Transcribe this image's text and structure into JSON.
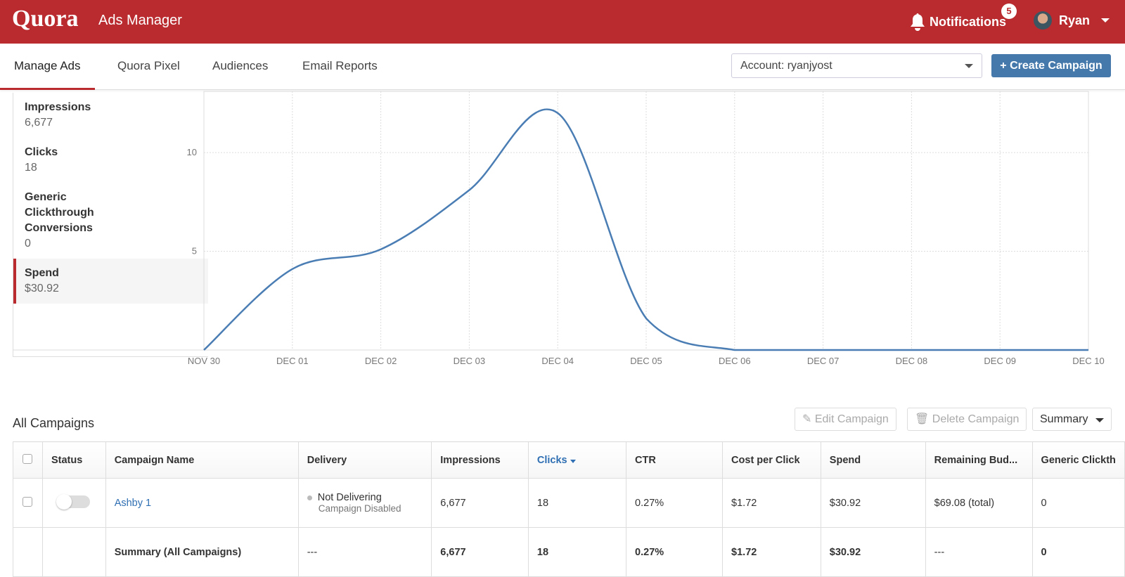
{
  "header": {
    "logo": "Quora",
    "app_title": "Ads Manager",
    "notifications_label": "Notifications",
    "notifications_count": "5",
    "user_name": "Ryan"
  },
  "nav": {
    "tabs": [
      {
        "label": "Manage Ads"
      },
      {
        "label": "Quora Pixel"
      },
      {
        "label": "Audiences"
      },
      {
        "label": "Email Reports"
      }
    ],
    "account_select": "Account: ryanjyost",
    "create_button": "+ Create Campaign"
  },
  "metrics": [
    {
      "name": "Impressions",
      "value": "6,677"
    },
    {
      "name": "Clicks",
      "value": "18"
    },
    {
      "name": "Generic Clickthrough Conversions",
      "value": "0"
    },
    {
      "name": "Spend",
      "value": "$30.92"
    }
  ],
  "colors": {
    "brand": "#b92b2f",
    "line": "#4a7db3",
    "primary": "#4579ab"
  },
  "chart_data": {
    "type": "line",
    "title": "Spend",
    "x": [
      "NOV 30",
      "DEC 01",
      "DEC 02",
      "DEC 03",
      "DEC 04",
      "DEC 05",
      "DEC 06",
      "DEC 07",
      "DEC 08",
      "DEC 09",
      "DEC 10"
    ],
    "series": [
      {
        "name": "Spend",
        "values": [
          0,
          4.1,
          5.1,
          8.1,
          12,
          1.6,
          0,
          0,
          0,
          0,
          0
        ]
      }
    ],
    "yticks": [
      5,
      10
    ],
    "ylim": [
      0,
      13.1
    ],
    "grid": true
  },
  "campaigns": {
    "title": "All Campaigns",
    "edit_button": "Edit Campaign",
    "delete_button": "Delete Campaign",
    "view_select": "Summary",
    "columns": [
      "Status",
      "Campaign Name",
      "Delivery",
      "Impressions",
      "Clicks",
      "CTR",
      "Cost per Click",
      "Spend",
      "Remaining Bud...",
      "Generic Clickth"
    ],
    "rows": [
      {
        "name": "Ashby 1",
        "delivery": "Not Delivering",
        "delivery_sub": "Campaign Disabled",
        "impressions": "6,677",
        "clicks": "18",
        "ctr": "0.27%",
        "cpc": "$1.72",
        "spend": "$30.92",
        "remaining": "$69.08 (total)",
        "conversions": "0"
      }
    ],
    "summary": {
      "name": "Summary (All Campaigns)",
      "delivery": "---",
      "impressions": "6,677",
      "clicks": "18",
      "ctr": "0.27%",
      "cpc": "$1.72",
      "spend": "$30.92",
      "remaining": "---",
      "conversions": "0"
    }
  }
}
